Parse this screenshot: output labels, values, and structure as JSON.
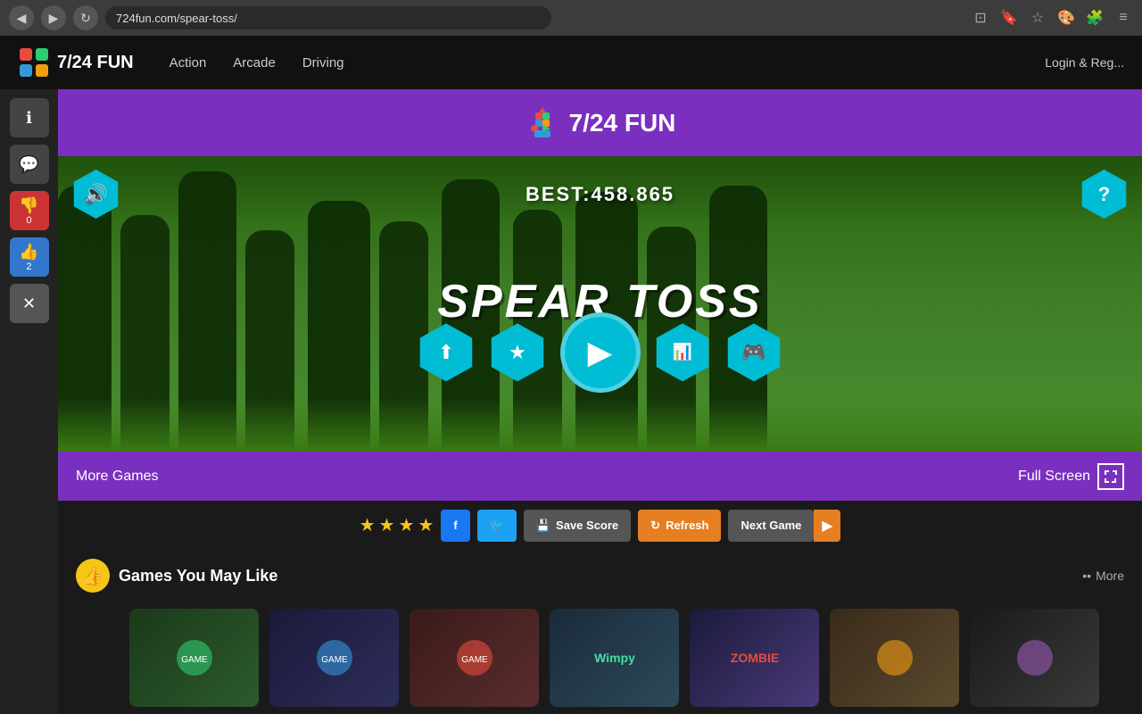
{
  "browser": {
    "url": "724fun.com/spear-toss/",
    "back_icon": "◀",
    "forward_icon": "▶",
    "refresh_icon": "↻"
  },
  "site": {
    "logo_text": "7/24 FUN",
    "nav": {
      "action": "Action",
      "arcade": "Arcade",
      "driving": "Driving"
    },
    "login": "Login & Reg..."
  },
  "game_header": {
    "logo_text": "7/24 FUN"
  },
  "game": {
    "title": "SPEAR TOSS",
    "best_score": "BEST:458.865",
    "back_best": "BEST",
    "sound_icon": "🔊",
    "help_icon": "?",
    "share_icon": "⬆",
    "star_icon": "★",
    "play_icon": "▶",
    "leaderboard_icon": "📊",
    "gamepad_icon": "🎮"
  },
  "bottom_bar": {
    "more_games": "More Games",
    "full_screen": "Full Screen"
  },
  "toolbar": {
    "stars": [
      "★",
      "★",
      "★",
      "★"
    ],
    "fb_icon": "f",
    "tw_icon": "t",
    "save_score": "Save Score",
    "refresh": "Refresh",
    "next_game": "Next Game"
  },
  "games_section": {
    "title": "Games You May Like",
    "more": "•• More",
    "thumb_icon": "👍"
  },
  "sidebar": {
    "info_icon": "ℹ",
    "comment_icon": "💬",
    "dislike_icon": "👎",
    "dislike_count": "0",
    "like_icon": "👍",
    "like_count": "2",
    "close_icon": "✕"
  },
  "colors": {
    "purple": "#7b2fbe",
    "teal": "#00bcd4",
    "green_forest": "#3d7a25",
    "orange": "#e67e22"
  }
}
